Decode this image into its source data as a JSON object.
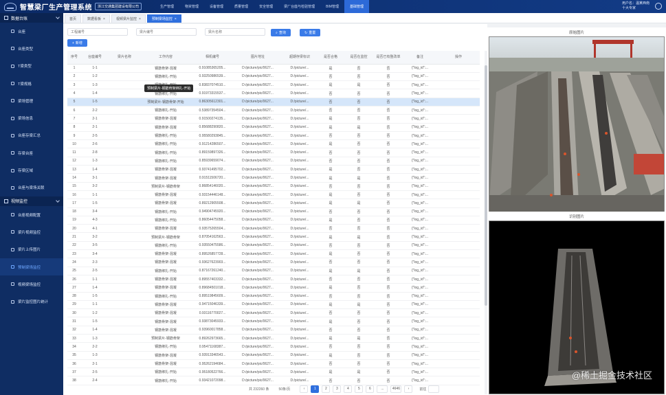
{
  "app": {
    "title": "智慧梁厂生产管理系统",
    "subtitle": "浙江交通集团建设有限公司",
    "user_line1": "用户名：温某西南",
    "user_line2": "十大专家"
  },
  "nav": [
    "生产管理",
    "物资管理",
    "设备管理",
    "质量管理",
    "安全管理",
    "梁厂台座与检验管理",
    "BIM管理",
    "基础管理"
  ],
  "sidebar": {
    "groups": [
      {
        "label": "数据台账",
        "items": [
          "台座",
          "台座类型",
          "T梁类型",
          "T梁规格",
          "梁场管理",
          "梁场信息",
          "台座存梁汇总",
          "存梁台座",
          "存梁区域",
          "台座与梁场关联"
        ]
      },
      {
        "label": "视频监控",
        "items": [
          "台座视频配置",
          "梁片视频监控",
          "梁片上传图片",
          "预制梁场监控",
          "视频梁场监控",
          "梁片监控图片统计"
        ]
      }
    ]
  },
  "tabs": [
    "首页",
    "数据看板",
    "视频梁片监控",
    "预制梁场监控"
  ],
  "filters": {
    "placeholder1": "工程编号",
    "placeholder2": "梁片编号",
    "placeholder3": "梁片名称",
    "search_label": "查询",
    "reset_label": "重置",
    "add_label": "新增"
  },
  "table": {
    "headers": [
      "序号",
      "台座编号",
      "梁片名称",
      "工作内容",
      "相机编号",
      "图片地址",
      "超期存梁标识",
      "是否合格",
      "是否在监控",
      "是否已有整改单",
      "备注",
      "操作"
    ],
    "tooltip": "预制梁片-钢筋骨架绑扎-开始",
    "rows": [
      [
        "1",
        "1-1",
        "",
        "钢筋骨架-混凝",
        "0.91085365205...",
        "D:/picture/pic/0627...",
        "D:/picture/...",
        "是",
        "否",
        "否",
        "{\"log_id\":...",
        ""
      ],
      [
        "2",
        "1-2",
        "",
        "钢筋绑扎-开始",
        "0.93250986539...",
        "D:/picture/pic/0627...",
        "D:/picture/...",
        "否",
        "否",
        "否",
        "{\"log_id\":...",
        ""
      ],
      [
        "3",
        "1-3",
        "",
        "钢筋绑扎-开始",
        "0.83837074510...",
        "D:/picture/pic/0627...",
        "D:/picture/...",
        "是",
        "是",
        "否",
        "{\"log_id\":...",
        ""
      ],
      [
        "4",
        "1-4",
        "",
        "钢筋绑扎-开始",
        "0.91973315537...",
        "D:/picture/pic/0627...",
        "D:/picture/...",
        "否",
        "否",
        "否",
        "{\"log_id\":...",
        ""
      ],
      [
        "5",
        "1-5",
        "",
        "预制梁片-钢筋骨架-开始",
        "0.86305612301...",
        "D:/picture/pic/0627...",
        "D:/picture/...",
        "否",
        "否",
        "否",
        "{\"log_id\":...",
        ""
      ],
      [
        "6",
        "2-2",
        "",
        "钢筋绑扎-开始",
        "0.53897354504...",
        "D:/picture/pic/0627...",
        "D:/picture/...",
        "否",
        "否",
        "否",
        "{\"log_id\":...",
        ""
      ],
      [
        "7",
        "2-1",
        "",
        "钢筋骨架-混凝",
        "0.91500274135...",
        "D:/picture/pic/0627...",
        "D:/picture/...",
        "是",
        "否",
        "否",
        "{\"log_id\":...",
        ""
      ],
      [
        "8",
        "2-1",
        "",
        "钢筋骨架-混凝",
        "0.85688290820...",
        "D:/picture/pic/0627...",
        "D:/picture/...",
        "是",
        "是",
        "否",
        "{\"log_id\":...",
        ""
      ],
      [
        "9",
        "2-5",
        "",
        "钢筋绑扎-开始",
        "0.95580293845...",
        "D:/picture/pic/0627...",
        "D:/picture/...",
        "否",
        "否",
        "否",
        "{\"log_id\":...",
        ""
      ],
      [
        "10",
        "2-6",
        "",
        "钢筋绑扎-开始",
        "0.91214286507...",
        "D:/picture/pic/0627...",
        "D:/picture/...",
        "是",
        "否",
        "否",
        "{\"log_id\":...",
        ""
      ],
      [
        "11",
        "2-8",
        "",
        "钢筋绑扎-开始",
        "0.89159897326...",
        "D:/picture/pic/0627...",
        "D:/picture/...",
        "否",
        "否",
        "否",
        "{\"log_id\":...",
        ""
      ],
      [
        "12",
        "1-3",
        "",
        "钢筋绑扎-开始",
        "0.85939659074...",
        "D:/picture/pic/0627...",
        "D:/picture/...",
        "否",
        "否",
        "否",
        "{\"log_id\":...",
        ""
      ],
      [
        "13",
        "1-4",
        "",
        "钢筋骨架-混凝",
        "0.93741495702...",
        "D:/picture/pic/0627...",
        "D:/picture/...",
        "是",
        "否",
        "否",
        "{\"log_id\":...",
        ""
      ],
      [
        "14",
        "3-1",
        "",
        "钢筋骨架-混凝",
        "0.91511506720...",
        "D:/picture/pic/0627...",
        "D:/picture/...",
        "是",
        "是",
        "否",
        "{\"log_id\":...",
        ""
      ],
      [
        "15",
        "3-2",
        "",
        "预制梁片-钢筋骨架",
        "0.86854146020...",
        "D:/picture/pic/0627...",
        "D:/picture/...",
        "否",
        "否",
        "否",
        "{\"log_id\":...",
        ""
      ],
      [
        "16",
        "1-1",
        "",
        "钢筋骨架-混凝",
        "0.93154446148...",
        "D:/picture/pic/0627...",
        "D:/picture/...",
        "是",
        "否",
        "否",
        "{\"log_id\":...",
        ""
      ],
      [
        "17",
        "1-5",
        "",
        "钢筋骨架-混凝",
        "0.89212905508...",
        "D:/picture/pic/0627...",
        "D:/picture/...",
        "是",
        "是",
        "否",
        "{\"log_id\":...",
        ""
      ],
      [
        "18",
        "3-4",
        "",
        "钢筋绑扎-开始",
        "0.94904745920...",
        "D:/picture/pic/0627...",
        "D:/picture/...",
        "否",
        "否",
        "否",
        "{\"log_id\":...",
        ""
      ],
      [
        "19",
        "4-3",
        "",
        "钢筋绑扎-开始",
        "0.86054475058...",
        "D:/picture/pic/0627...",
        "D:/picture/...",
        "是",
        "否",
        "否",
        "{\"log_id\":...",
        ""
      ],
      [
        "20",
        "4-1",
        "",
        "钢筋骨架-混凝",
        "0.93575265504...",
        "D:/picture/pic/0627...",
        "D:/picture/...",
        "否",
        "否",
        "否",
        "{\"log_id\":...",
        ""
      ],
      [
        "21",
        "3-2",
        "",
        "预制梁片-钢筋骨架",
        "0.87054162563...",
        "D:/picture/pic/0627...",
        "D:/picture/...",
        "是",
        "是",
        "否",
        "{\"log_id\":...",
        ""
      ],
      [
        "22",
        "3-5",
        "",
        "钢筋绑扎-开始",
        "0.93550475586...",
        "D:/picture/pic/0627...",
        "D:/picture/...",
        "否",
        "否",
        "否",
        "{\"log_id\":...",
        ""
      ],
      [
        "23",
        "3-4",
        "",
        "钢筋骨架-混凝",
        "0.89526857728...",
        "D:/picture/pic/0627...",
        "D:/picture/...",
        "是",
        "否",
        "否",
        "{\"log_id\":...",
        ""
      ],
      [
        "24",
        "2-3",
        "",
        "钢筋骨架-混凝",
        "0.93627623903...",
        "D:/picture/pic/0627...",
        "D:/picture/...",
        "否",
        "否",
        "否",
        "{\"log_id\":...",
        ""
      ],
      [
        "25",
        "2-5",
        "",
        "钢筋绑扎-开始",
        "0.87167261240...",
        "D:/picture/pic/0627...",
        "D:/picture/...",
        "是",
        "是",
        "否",
        "{\"log_id\":...",
        ""
      ],
      [
        "26",
        "1-1",
        "",
        "钢筋骨架-混凝",
        "0.89557403332...",
        "D:/picture/pic/0627...",
        "D:/picture/...",
        "否",
        "否",
        "否",
        "{\"log_id\":...",
        ""
      ],
      [
        "27",
        "1-4",
        "",
        "钢筋骨架-混凝",
        "0.89684501018...",
        "D:/picture/pic/0627...",
        "D:/picture/...",
        "是",
        "否",
        "否",
        "{\"log_id\":...",
        ""
      ],
      [
        "28",
        "1-5",
        "",
        "钢筋绑扎-开始",
        "0.89519845609...",
        "D:/picture/pic/0627...",
        "D:/picture/...",
        "否",
        "否",
        "否",
        "{\"log_id\":...",
        ""
      ],
      [
        "29",
        "1-1",
        "",
        "钢筋骨架-混凝",
        "0.94715046339...",
        "D:/picture/pic/0627...",
        "D:/picture/...",
        "是",
        "是",
        "否",
        "{\"log_id\":...",
        ""
      ],
      [
        "30",
        "1-2",
        "",
        "钢筋骨架-混凝",
        "0.93116770027...",
        "D:/picture/pic/0627...",
        "D:/picture/...",
        "否",
        "否",
        "否",
        "{\"log_id\":...",
        ""
      ],
      [
        "31",
        "1-5",
        "",
        "钢筋骨架-混凝",
        "0.93873045933...",
        "D:/picture/pic/0627...",
        "D:/picture/...",
        "是",
        "否",
        "否",
        "{\"log_id\":...",
        ""
      ],
      [
        "32",
        "1-4",
        "",
        "钢筋骨架-混凝",
        "0.93960017858...",
        "D:/picture/pic/0627...",
        "D:/picture/...",
        "否",
        "否",
        "否",
        "{\"log_id\":...",
        ""
      ],
      [
        "33",
        "1-3",
        "",
        "预制梁片-钢筋骨架",
        "0.89262973665...",
        "D:/picture/pic/0627...",
        "D:/picture/...",
        "是",
        "是",
        "否",
        "{\"log_id\":...",
        ""
      ],
      [
        "34",
        "2-2",
        "",
        "钢筋绑扎-开始",
        "0.95471168387...",
        "D:/picture/pic/0627...",
        "D:/picture/...",
        "否",
        "否",
        "否",
        "{\"log_id\":...",
        ""
      ],
      [
        "35",
        "1-3",
        "",
        "钢筋骨架-混凝",
        "0.93913346543...",
        "D:/picture/pic/0627...",
        "D:/picture/...",
        "是",
        "否",
        "否",
        "{\"log_id\":...",
        ""
      ],
      [
        "36",
        "2-1",
        "",
        "钢筋骨架-混凝",
        "0.95262194684...",
        "D:/picture/pic/0627...",
        "D:/picture/...",
        "否",
        "否",
        "否",
        "{\"log_id\":...",
        ""
      ],
      [
        "37",
        "2-5",
        "",
        "钢筋绑扎-开始",
        "0.95180522766...",
        "D:/picture/pic/0627...",
        "D:/picture/...",
        "是",
        "是",
        "否",
        "{\"log_id\":...",
        ""
      ],
      [
        "38",
        "2-4",
        "",
        "钢筋绑扎-开始",
        "0.93421072098...",
        "D:/picture/pic/0627...",
        "D:/picture/...",
        "否",
        "否",
        "否",
        "{\"log_id\":...",
        ""
      ]
    ]
  },
  "pager": {
    "total": "共 232260 条",
    "per_page": "50条/页",
    "pages": [
      "1",
      "2",
      "3",
      "4",
      "5",
      "6",
      "...",
      "4646"
    ],
    "active_page": "1",
    "goto": "前往"
  },
  "photos": {
    "top_title": "原始图片",
    "bottom_title": "识别图片"
  },
  "watermark": "@稀土掘金技术社区",
  "colors": {
    "header": "#0b2a66",
    "sidebar": "#0f2d63",
    "accent": "#2f6fde",
    "highlight_row": "#d5e6fa"
  }
}
